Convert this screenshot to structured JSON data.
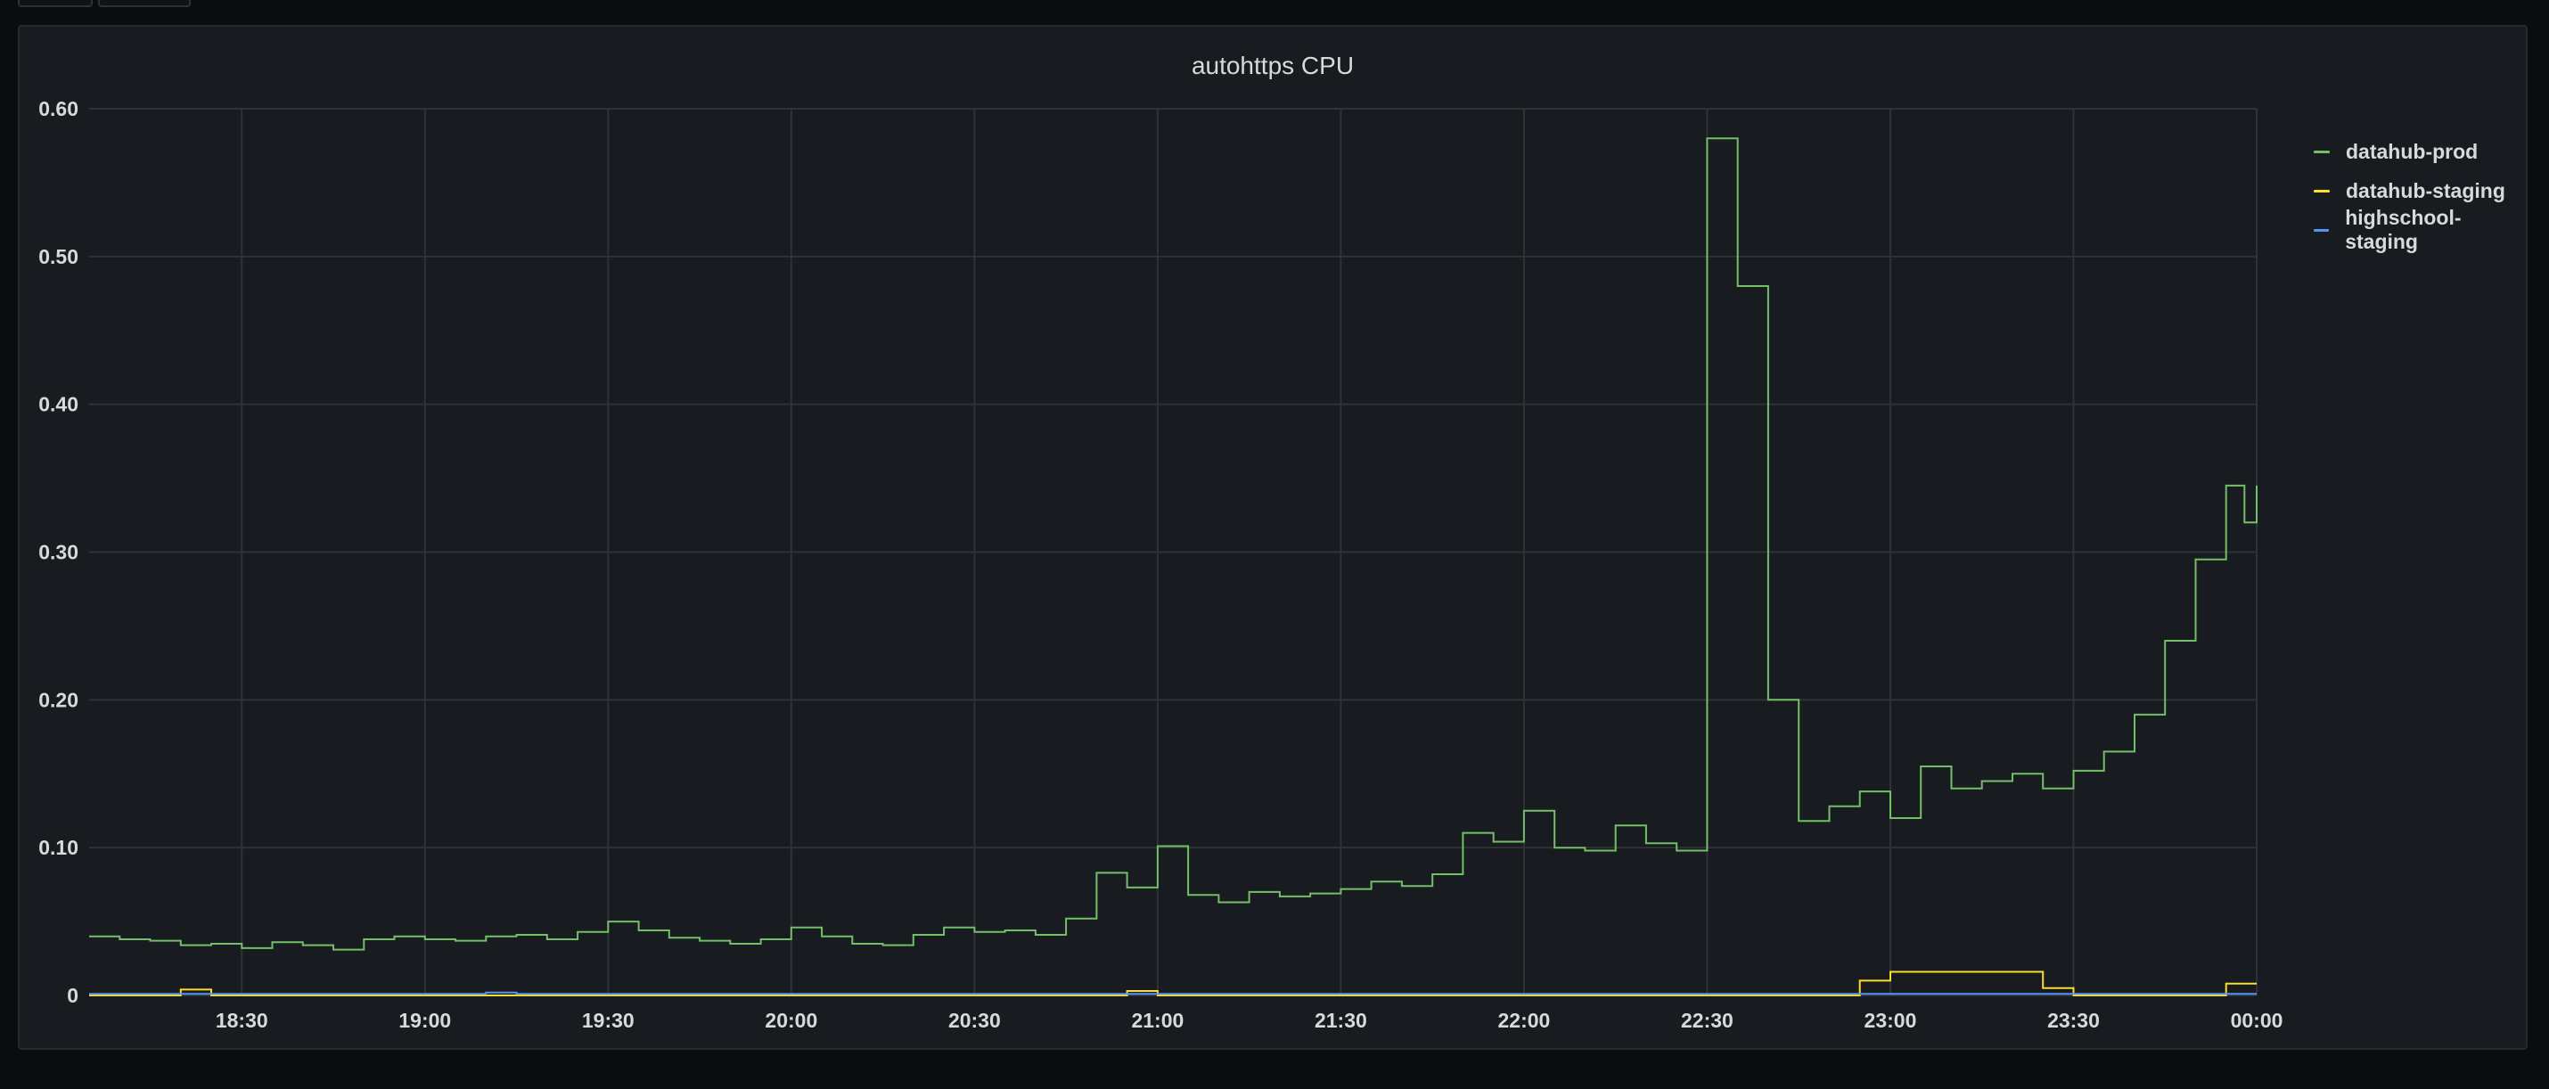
{
  "panel": {
    "title": "autohttps CPU"
  },
  "chart_data": {
    "type": "line",
    "title": "autohttps CPU",
    "xlabel": "",
    "ylabel": "",
    "x_range": [
      "18:05",
      "00:00"
    ],
    "ylim": [
      0,
      0.6
    ],
    "y_ticks": [
      {
        "value": 0,
        "label": "0"
      },
      {
        "value": 0.1,
        "label": "0.10"
      },
      {
        "value": 0.2,
        "label": "0.20"
      },
      {
        "value": 0.3,
        "label": "0.30"
      },
      {
        "value": 0.4,
        "label": "0.40"
      },
      {
        "value": 0.5,
        "label": "0.50"
      },
      {
        "value": 0.6,
        "label": "0.60"
      }
    ],
    "x_ticks": [
      "18:30",
      "19:00",
      "19:30",
      "20:00",
      "20:30",
      "21:00",
      "21:30",
      "22:00",
      "22:30",
      "23:00",
      "23:30",
      "00:00"
    ],
    "grid": true,
    "legend_position": "right",
    "series": [
      {
        "name": "datahub-prod",
        "color": "#73bf69",
        "points": [
          [
            "18:05",
            0.04
          ],
          [
            "18:10",
            0.038
          ],
          [
            "18:15",
            0.037
          ],
          [
            "18:20",
            0.034
          ],
          [
            "18:25",
            0.035
          ],
          [
            "18:30",
            0.032
          ],
          [
            "18:35",
            0.036
          ],
          [
            "18:40",
            0.034
          ],
          [
            "18:45",
            0.031
          ],
          [
            "18:50",
            0.038
          ],
          [
            "18:55",
            0.04
          ],
          [
            "19:00",
            0.038
          ],
          [
            "19:05",
            0.037
          ],
          [
            "19:10",
            0.04
          ],
          [
            "19:15",
            0.041
          ],
          [
            "19:20",
            0.038
          ],
          [
            "19:25",
            0.043
          ],
          [
            "19:30",
            0.05
          ],
          [
            "19:35",
            0.044
          ],
          [
            "19:40",
            0.039
          ],
          [
            "19:45",
            0.037
          ],
          [
            "19:50",
            0.035
          ],
          [
            "19:55",
            0.038
          ],
          [
            "20:00",
            0.046
          ],
          [
            "20:05",
            0.04
          ],
          [
            "20:10",
            0.035
          ],
          [
            "20:15",
            0.034
          ],
          [
            "20:20",
            0.041
          ],
          [
            "20:25",
            0.046
          ],
          [
            "20:30",
            0.043
          ],
          [
            "20:35",
            0.044
          ],
          [
            "20:40",
            0.041
          ],
          [
            "20:45",
            0.052
          ],
          [
            "20:50",
            0.083
          ],
          [
            "20:55",
            0.073
          ],
          [
            "21:00",
            0.101
          ],
          [
            "21:05",
            0.068
          ],
          [
            "21:10",
            0.063
          ],
          [
            "21:15",
            0.07
          ],
          [
            "21:20",
            0.067
          ],
          [
            "21:25",
            0.069
          ],
          [
            "21:30",
            0.072
          ],
          [
            "21:35",
            0.077
          ],
          [
            "21:40",
            0.074
          ],
          [
            "21:45",
            0.082
          ],
          [
            "21:50",
            0.11
          ],
          [
            "21:55",
            0.104
          ],
          [
            "22:00",
            0.125
          ],
          [
            "22:05",
            0.1
          ],
          [
            "22:10",
            0.098
          ],
          [
            "22:15",
            0.115
          ],
          [
            "22:20",
            0.103
          ],
          [
            "22:25",
            0.098
          ],
          [
            "22:30",
            0.58
          ],
          [
            "22:35",
            0.48
          ],
          [
            "22:40",
            0.2
          ],
          [
            "22:45",
            0.118
          ],
          [
            "22:50",
            0.128
          ],
          [
            "22:55",
            0.138
          ],
          [
            "23:00",
            0.12
          ],
          [
            "23:05",
            0.155
          ],
          [
            "23:10",
            0.14
          ],
          [
            "23:15",
            0.145
          ],
          [
            "23:20",
            0.15
          ],
          [
            "23:25",
            0.14
          ],
          [
            "23:30",
            0.152
          ],
          [
            "23:35",
            0.165
          ],
          [
            "23:40",
            0.19
          ],
          [
            "23:45",
            0.24
          ],
          [
            "23:50",
            0.295
          ],
          [
            "23:55",
            0.345
          ],
          [
            "23:58",
            0.32
          ],
          [
            "00:00",
            0.345
          ]
        ]
      },
      {
        "name": "datahub-staging",
        "color": "#fade2a",
        "points": [
          [
            "18:05",
            0
          ],
          [
            "18:20",
            0.004
          ],
          [
            "18:25",
            0
          ],
          [
            "20:55",
            0.003
          ],
          [
            "21:00",
            0
          ],
          [
            "22:55",
            0.01
          ],
          [
            "23:00",
            0.016
          ],
          [
            "23:20",
            0.016
          ],
          [
            "23:25",
            0.005
          ],
          [
            "23:30",
            0
          ],
          [
            "23:50",
            0
          ],
          [
            "23:55",
            0.008
          ],
          [
            "00:00",
            0.008
          ]
        ]
      },
      {
        "name": "highschool-staging",
        "color": "#5794f2",
        "points": [
          [
            "18:05",
            0.001
          ],
          [
            "19:10",
            0.002
          ],
          [
            "19:15",
            0.001
          ],
          [
            "00:00",
            0.001
          ]
        ]
      }
    ]
  }
}
